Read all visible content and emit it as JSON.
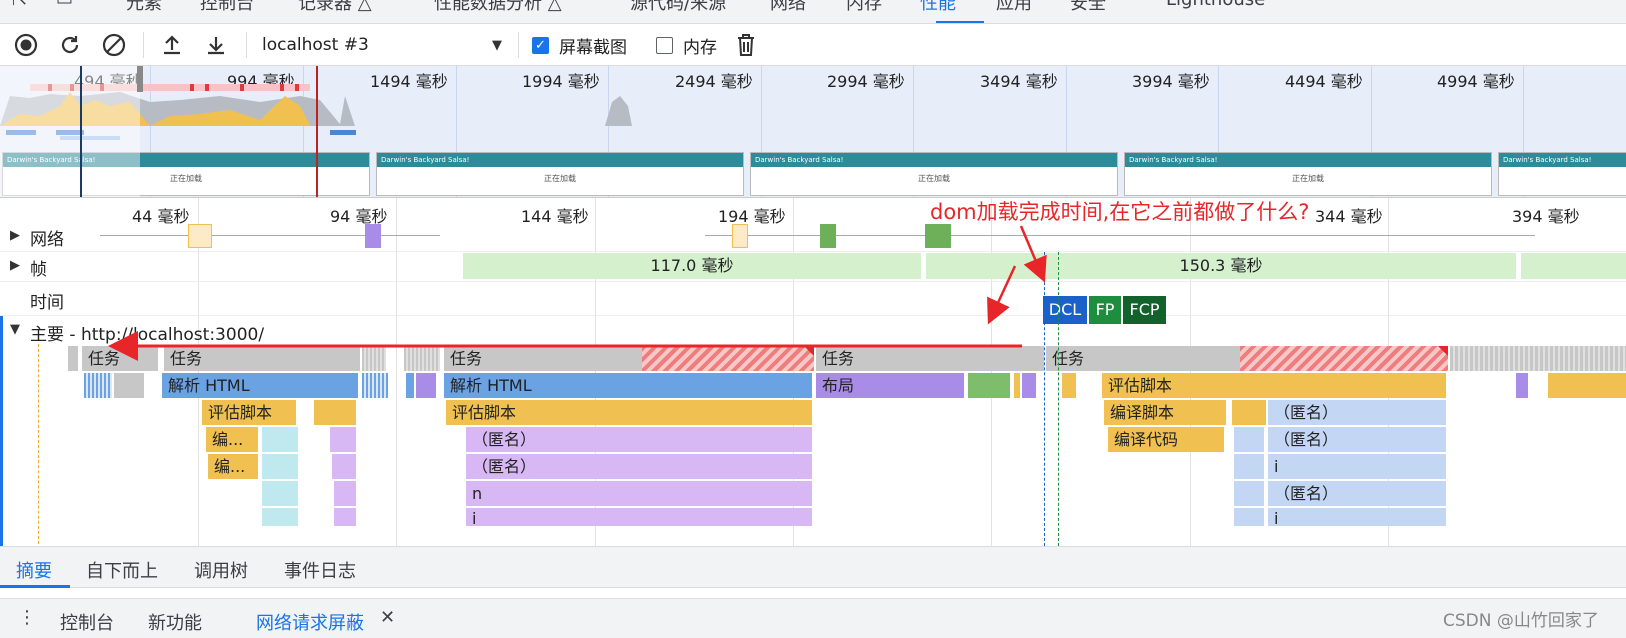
{
  "top_tabs": [
    {
      "label": "元素",
      "active": false
    },
    {
      "label": "控制台",
      "active": false
    },
    {
      "label": "记录器 △",
      "active": false
    },
    {
      "label": "性能数据分析 △",
      "active": false
    },
    {
      "label": "源代码/来源",
      "active": false
    },
    {
      "label": "网络",
      "active": false
    },
    {
      "label": "内存",
      "active": false
    },
    {
      "label": "性能",
      "active": true
    },
    {
      "label": "应用",
      "active": false
    },
    {
      "label": "安全",
      "active": false
    },
    {
      "label": "Lighthouse",
      "active": false
    }
  ],
  "toolbar": {
    "profile_select": "localhost #3",
    "screenshots_label": "屏幕截图",
    "screenshots_checked": true,
    "memory_label": "内存",
    "memory_checked": false
  },
  "overview": {
    "ticks": [
      "494 毫秒",
      "994 毫秒",
      "1494 毫秒",
      "1994 毫秒",
      "2494 毫秒",
      "2994 毫秒",
      "3494 毫秒",
      "3994 毫秒",
      "4494 毫秒",
      "4994 毫秒"
    ],
    "screenshot_title": "Darwin's Backyard Salsa!",
    "screenshot_body": "正在加载"
  },
  "ruler": {
    "ticks": [
      "44 毫秒",
      "94 毫秒",
      "144 毫秒",
      "194 毫秒",
      "344 毫秒",
      "394 毫秒"
    ]
  },
  "tracks": {
    "network": "网络",
    "frames": "帧",
    "timings": "时间",
    "main": "主要 - http://localhost:3000/"
  },
  "frames": {
    "f1": "117.0 毫秒",
    "f2": "150.3 毫秒"
  },
  "markers": {
    "dcl": "DCL",
    "fp": "FP",
    "fcp": "FCP"
  },
  "flame": {
    "task": "任务",
    "parse_html": "解析 HTML",
    "eval_script": "评估脚本",
    "compile_short": "编...",
    "anon": "（匿名）",
    "n": "n",
    "i": "i",
    "layout": "布局",
    "compile_script": "编译脚本",
    "compile_code": "编译代码"
  },
  "annotation": "dom加载完成时间,在它之前都做了什么?",
  "bottom_tabs": [
    {
      "label": "摘要",
      "active": true
    },
    {
      "label": "自下而上",
      "active": false
    },
    {
      "label": "调用树",
      "active": false
    },
    {
      "label": "事件日志",
      "active": false
    }
  ],
  "drawer": {
    "console": "控制台",
    "whats_new": "新功能",
    "network_blocking": "网络请求屏蔽"
  },
  "watermark": "CSDN @山竹回家了",
  "colors": {
    "accent": "#1a73e8",
    "annotation": "#e8262a"
  }
}
